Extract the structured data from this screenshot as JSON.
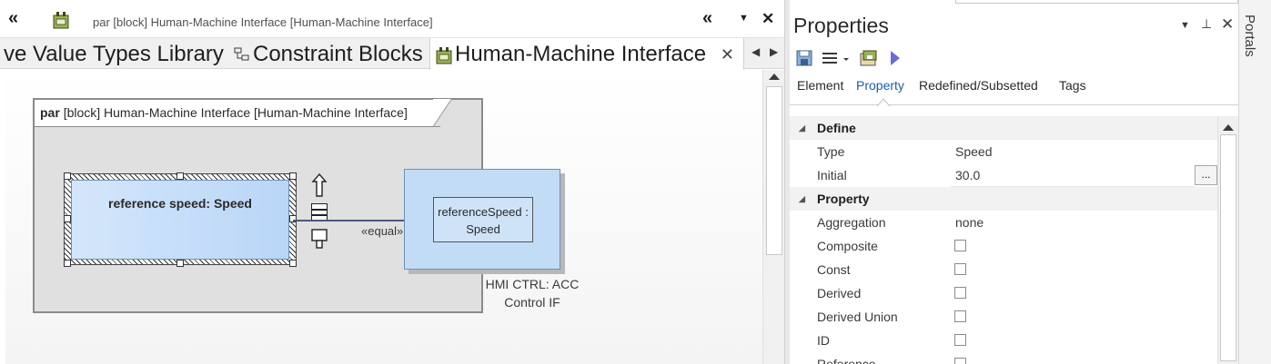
{
  "diagram_window": {
    "title": "par [block] Human-Machine Interface [Human-Machine Interface]",
    "tabs": [
      {
        "label": "ve Value Types Library"
      },
      {
        "label": "Constraint Blocks"
      },
      {
        "label": "Human-Machine Interface"
      }
    ],
    "active_tab": "Human-Machine Interface"
  },
  "diagram": {
    "frame_kind": "par",
    "frame_label": "[block] Human-Machine Interface [Human-Machine Interface]",
    "reference_block": "reference speed: Speed",
    "connector_label": "«equal»",
    "hmi_part_line1": "referenceSpeed :",
    "hmi_part_line2": "Speed",
    "hmi_block_line1": "HMI CTRL: ACC",
    "hmi_block_line2": "Control IF"
  },
  "properties": {
    "title": "Properties",
    "tabs": [
      "Element",
      "Property",
      "Redefined/Subsetted",
      "Tags"
    ],
    "active_tab": "Property",
    "sections": [
      {
        "name": "Define",
        "rows": [
          {
            "label": "Type",
            "value": "Speed"
          },
          {
            "label": "Initial",
            "value": "30.0",
            "button": "..."
          }
        ]
      },
      {
        "name": "Property",
        "rows": [
          {
            "label": "Aggregation",
            "value": "none"
          },
          {
            "label": "Composite",
            "checked": false
          },
          {
            "label": "Const",
            "checked": false
          },
          {
            "label": "Derived",
            "checked": false
          },
          {
            "label": "Derived Union",
            "checked": false
          },
          {
            "label": "ID",
            "checked": false
          },
          {
            "label": "Reference",
            "checked": false
          }
        ]
      }
    ]
  },
  "portals": {
    "label": "Portals"
  },
  "colors": {
    "selection_blue": "#c3dcf6",
    "accent_blue": "#1a5dab",
    "frame_grey": "#e0e0e0"
  }
}
